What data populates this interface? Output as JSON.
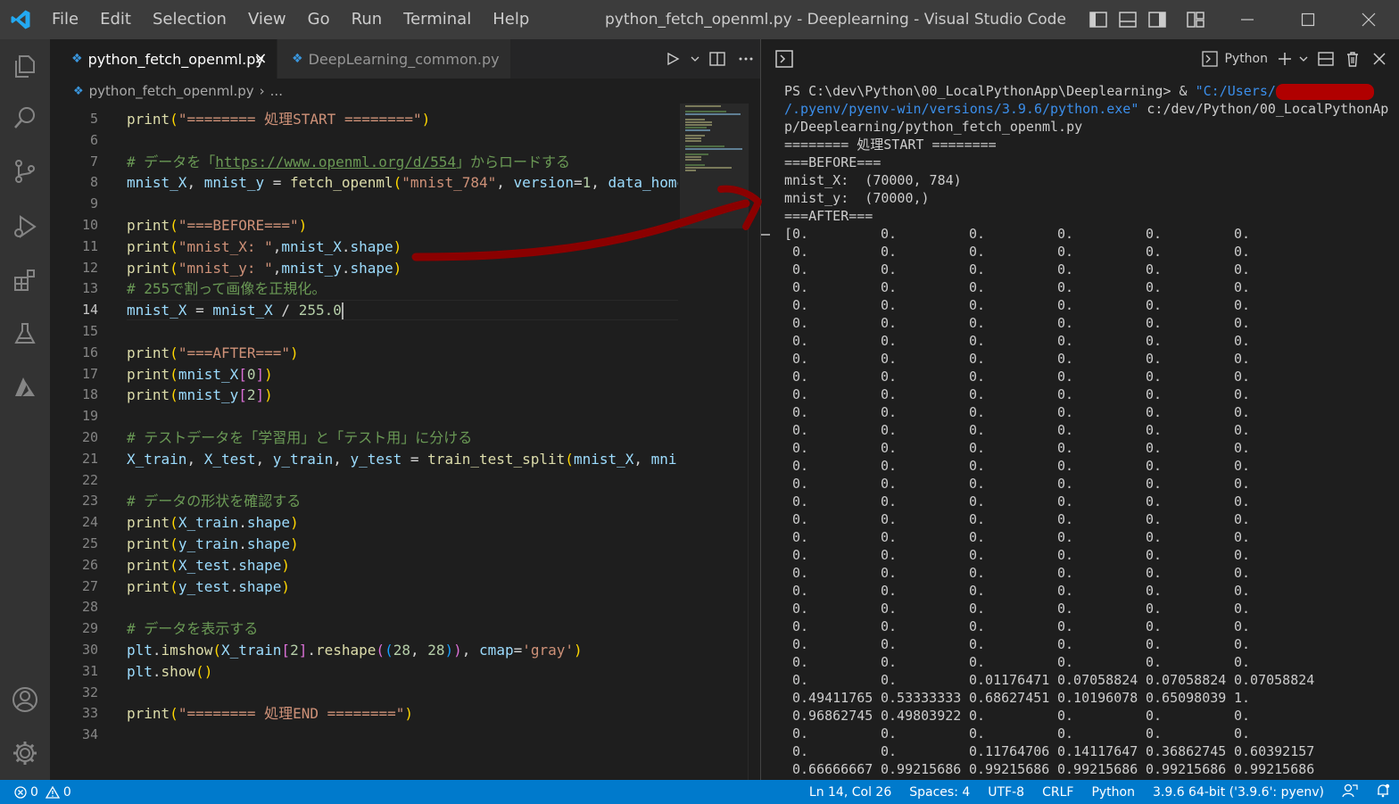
{
  "window": {
    "title": "python_fetch_openml.py - Deeplearning - Visual Studio Code",
    "menu": [
      "File",
      "Edit",
      "Selection",
      "View",
      "Go",
      "Run",
      "Terminal",
      "Help"
    ]
  },
  "tabs": {
    "active": "python_fetch_openml.py",
    "inactive": "DeepLearning_common.py"
  },
  "breadcrumb": {
    "file": "python_fetch_openml.py",
    "more": "..."
  },
  "editor": {
    "active_line": 14,
    "lines": [
      {
        "n": 5,
        "tokens": [
          [
            "fn",
            "print"
          ],
          [
            "b1",
            "("
          ],
          [
            "str",
            "\"======== 処理START ========\""
          ],
          [
            "b1",
            ")"
          ]
        ]
      },
      {
        "n": 6,
        "tokens": []
      },
      {
        "n": 7,
        "tokens": [
          [
            "cm",
            "# データを「"
          ],
          [
            "url",
            "https://www.openml.org/d/554"
          ],
          [
            "cm",
            "」からロードする"
          ]
        ]
      },
      {
        "n": 8,
        "tokens": [
          [
            "vr",
            "mnist_X"
          ],
          [
            "df",
            ", "
          ],
          [
            "vr",
            "mnist_y"
          ],
          [
            "df",
            " = "
          ],
          [
            "fn",
            "fetch_openml"
          ],
          [
            "b1",
            "("
          ],
          [
            "str",
            "\"mnist_784\""
          ],
          [
            "df",
            ", "
          ],
          [
            "vr",
            "version"
          ],
          [
            "df",
            "="
          ],
          [
            "nm",
            "1"
          ],
          [
            "df",
            ", "
          ],
          [
            "vr",
            "data_home"
          ]
        ]
      },
      {
        "n": 9,
        "tokens": []
      },
      {
        "n": 10,
        "tokens": [
          [
            "fn",
            "print"
          ],
          [
            "b1",
            "("
          ],
          [
            "str",
            "\"===BEFORE===\""
          ],
          [
            "b1",
            ")"
          ]
        ]
      },
      {
        "n": 11,
        "tokens": [
          [
            "fn",
            "print"
          ],
          [
            "b1",
            "("
          ],
          [
            "str",
            "\"mnist_X: \""
          ],
          [
            "df",
            ","
          ],
          [
            "vr",
            "mnist_X"
          ],
          [
            "df",
            "."
          ],
          [
            "vr",
            "shape"
          ],
          [
            "b1",
            ")"
          ]
        ]
      },
      {
        "n": 12,
        "tokens": [
          [
            "fn",
            "print"
          ],
          [
            "b1",
            "("
          ],
          [
            "str",
            "\"mnist_y: \""
          ],
          [
            "df",
            ","
          ],
          [
            "vr",
            "mnist_y"
          ],
          [
            "df",
            "."
          ],
          [
            "vr",
            "shape"
          ],
          [
            "b1",
            ")"
          ]
        ]
      },
      {
        "n": 13,
        "tokens": [
          [
            "cm",
            "# 255で割って画像を正規化。"
          ]
        ]
      },
      {
        "n": 14,
        "tokens": [
          [
            "vr",
            "mnist_X"
          ],
          [
            "df",
            " = "
          ],
          [
            "vr",
            "mnist_X"
          ],
          [
            "df",
            " / "
          ],
          [
            "nm",
            "255.0"
          ]
        ]
      },
      {
        "n": 15,
        "tokens": []
      },
      {
        "n": 16,
        "tokens": [
          [
            "fn",
            "print"
          ],
          [
            "b1",
            "("
          ],
          [
            "str",
            "\"===AFTER===\""
          ],
          [
            "b1",
            ")"
          ]
        ]
      },
      {
        "n": 17,
        "tokens": [
          [
            "fn",
            "print"
          ],
          [
            "b1",
            "("
          ],
          [
            "vr",
            "mnist_X"
          ],
          [
            "b2",
            "["
          ],
          [
            "nm",
            "0"
          ],
          [
            "b2",
            "]"
          ],
          [
            "b1",
            ")"
          ]
        ]
      },
      {
        "n": 18,
        "tokens": [
          [
            "fn",
            "print"
          ],
          [
            "b1",
            "("
          ],
          [
            "vr",
            "mnist_y"
          ],
          [
            "b2",
            "["
          ],
          [
            "nm",
            "2"
          ],
          [
            "b2",
            "]"
          ],
          [
            "b1",
            ")"
          ]
        ]
      },
      {
        "n": 19,
        "tokens": []
      },
      {
        "n": 20,
        "tokens": [
          [
            "cm",
            "# テストデータを「学習用」と「テスト用」に分ける"
          ]
        ]
      },
      {
        "n": 21,
        "tokens": [
          [
            "vr",
            "X_train"
          ],
          [
            "df",
            ", "
          ],
          [
            "vr",
            "X_test"
          ],
          [
            "df",
            ", "
          ],
          [
            "vr",
            "y_train"
          ],
          [
            "df",
            ", "
          ],
          [
            "vr",
            "y_test"
          ],
          [
            "df",
            " = "
          ],
          [
            "fn",
            "train_test_split"
          ],
          [
            "b1",
            "("
          ],
          [
            "vr",
            "mnist_X"
          ],
          [
            "df",
            ", "
          ],
          [
            "vr",
            "mnis"
          ]
        ]
      },
      {
        "n": 22,
        "tokens": []
      },
      {
        "n": 23,
        "tokens": [
          [
            "cm",
            "# データの形状を確認する"
          ]
        ]
      },
      {
        "n": 24,
        "tokens": [
          [
            "fn",
            "print"
          ],
          [
            "b1",
            "("
          ],
          [
            "vr",
            "X_train"
          ],
          [
            "df",
            "."
          ],
          [
            "vr",
            "shape"
          ],
          [
            "b1",
            ")"
          ]
        ]
      },
      {
        "n": 25,
        "tokens": [
          [
            "fn",
            "print"
          ],
          [
            "b1",
            "("
          ],
          [
            "vr",
            "y_train"
          ],
          [
            "df",
            "."
          ],
          [
            "vr",
            "shape"
          ],
          [
            "b1",
            ")"
          ]
        ]
      },
      {
        "n": 26,
        "tokens": [
          [
            "fn",
            "print"
          ],
          [
            "b1",
            "("
          ],
          [
            "vr",
            "X_test"
          ],
          [
            "df",
            "."
          ],
          [
            "vr",
            "shape"
          ],
          [
            "b1",
            ")"
          ]
        ]
      },
      {
        "n": 27,
        "tokens": [
          [
            "fn",
            "print"
          ],
          [
            "b1",
            "("
          ],
          [
            "vr",
            "y_test"
          ],
          [
            "df",
            "."
          ],
          [
            "vr",
            "shape"
          ],
          [
            "b1",
            ")"
          ]
        ]
      },
      {
        "n": 28,
        "tokens": []
      },
      {
        "n": 29,
        "tokens": [
          [
            "cm",
            "# データを表示する"
          ]
        ]
      },
      {
        "n": 30,
        "tokens": [
          [
            "vr",
            "plt"
          ],
          [
            "df",
            "."
          ],
          [
            "fn",
            "imshow"
          ],
          [
            "b1",
            "("
          ],
          [
            "vr",
            "X_train"
          ],
          [
            "b2",
            "["
          ],
          [
            "nm",
            "2"
          ],
          [
            "b2",
            "]"
          ],
          [
            "df",
            "."
          ],
          [
            "fn",
            "reshape"
          ],
          [
            "b2",
            "("
          ],
          [
            "b3",
            "("
          ],
          [
            "nm",
            "28"
          ],
          [
            "df",
            ", "
          ],
          [
            "nm",
            "28"
          ],
          [
            "b3",
            ")"
          ],
          [
            "b2",
            ")"
          ],
          [
            "df",
            ", "
          ],
          [
            "vr",
            "cmap"
          ],
          [
            "df",
            "="
          ],
          [
            "str",
            "'gray'"
          ],
          [
            "b1",
            ")"
          ]
        ]
      },
      {
        "n": 31,
        "tokens": [
          [
            "vr",
            "plt"
          ],
          [
            "df",
            "."
          ],
          [
            "fn",
            "show"
          ],
          [
            "b1",
            "()"
          ]
        ]
      },
      {
        "n": 32,
        "tokens": []
      },
      {
        "n": 33,
        "tokens": [
          [
            "fn",
            "print"
          ],
          [
            "b1",
            "("
          ],
          [
            "str",
            "\"======== 処理END ========\""
          ],
          [
            "b1",
            ")"
          ]
        ]
      },
      {
        "n": 34,
        "tokens": []
      }
    ]
  },
  "terminal": {
    "shell_name": "Python",
    "prompt_prefix": "PS C:\\dev\\Python\\00_LocalPythonApp\\Deeplearning> & ",
    "path_start": "\"C:/Users/",
    "path_cont": "/.pyenv/pyenv-win/versions/3.9.6/python.exe\"",
    "arg_start": " c:/dev/Python/00_LocalPythonAp",
    "arg_cont": "p/Deeplearning/python_fetch_openml.py",
    "output_lines": [
      "======== 処理START ========",
      "===BEFORE===",
      "mnist_X:  (70000, 784)",
      "mnist_y:  (70000,)",
      "===AFTER==="
    ],
    "array_rows": [
      [
        "0.",
        "0.",
        "0.",
        "0.",
        "0.",
        "0."
      ],
      [
        "0.",
        "0.",
        "0.",
        "0.",
        "0.",
        "0."
      ],
      [
        "0.",
        "0.",
        "0.",
        "0.",
        "0.",
        "0."
      ],
      [
        "0.",
        "0.",
        "0.",
        "0.",
        "0.",
        "0."
      ],
      [
        "0.",
        "0.",
        "0.",
        "0.",
        "0.",
        "0."
      ],
      [
        "0.",
        "0.",
        "0.",
        "0.",
        "0.",
        "0."
      ],
      [
        "0.",
        "0.",
        "0.",
        "0.",
        "0.",
        "0."
      ],
      [
        "0.",
        "0.",
        "0.",
        "0.",
        "0.",
        "0."
      ],
      [
        "0.",
        "0.",
        "0.",
        "0.",
        "0.",
        "0."
      ],
      [
        "0.",
        "0.",
        "0.",
        "0.",
        "0.",
        "0."
      ],
      [
        "0.",
        "0.",
        "0.",
        "0.",
        "0.",
        "0."
      ],
      [
        "0.",
        "0.",
        "0.",
        "0.",
        "0.",
        "0."
      ],
      [
        "0.",
        "0.",
        "0.",
        "0.",
        "0.",
        "0."
      ],
      [
        "0.",
        "0.",
        "0.",
        "0.",
        "0.",
        "0."
      ],
      [
        "0.",
        "0.",
        "0.",
        "0.",
        "0.",
        "0."
      ],
      [
        "0.",
        "0.",
        "0.",
        "0.",
        "0.",
        "0."
      ],
      [
        "0.",
        "0.",
        "0.",
        "0.",
        "0.",
        "0."
      ],
      [
        "0.",
        "0.",
        "0.",
        "0.",
        "0.",
        "0."
      ],
      [
        "0.",
        "0.",
        "0.",
        "0.",
        "0.",
        "0."
      ],
      [
        "0.",
        "0.",
        "0.",
        "0.",
        "0.",
        "0."
      ],
      [
        "0.",
        "0.",
        "0.",
        "0.",
        "0.",
        "0."
      ],
      [
        "0.",
        "0.",
        "0.",
        "0.",
        "0.",
        "0."
      ],
      [
        "0.",
        "0.",
        "0.",
        "0.",
        "0.",
        "0."
      ],
      [
        "0.",
        "0.",
        "0.",
        "0.",
        "0.",
        "0."
      ],
      [
        "0.",
        "0.",
        "0.",
        "0.",
        "0.",
        "0."
      ],
      [
        "0.",
        "0.",
        "0.01176471",
        "0.07058824",
        "0.07058824",
        "0.07058824"
      ],
      [
        "0.49411765",
        "0.53333333",
        "0.68627451",
        "0.10196078",
        "0.65098039",
        "1."
      ],
      [
        "0.96862745",
        "0.49803922",
        "0.",
        "0.",
        "0.",
        "0."
      ],
      [
        "0.",
        "0.",
        "0.",
        "0.",
        "0.",
        "0."
      ],
      [
        "0.",
        "0.",
        "0.11764706",
        "0.14117647",
        "0.36862745",
        "0.60392157"
      ],
      [
        "0.66666667",
        "0.99215686",
        "0.99215686",
        "0.99215686",
        "0.99215686",
        "0.99215686"
      ]
    ]
  },
  "statusbar": {
    "errors": "0",
    "warnings": "0",
    "position": "Ln 14, Col 26",
    "spaces": "Spaces: 4",
    "encoding": "UTF-8",
    "eol": "CRLF",
    "language": "Python",
    "interpreter": "3.9.6 64-bit ('3.9.6': pyenv)"
  },
  "colors": {
    "accent": "#007acc",
    "annotation_arrow": "#8b0000",
    "redaction": "#b00000"
  }
}
